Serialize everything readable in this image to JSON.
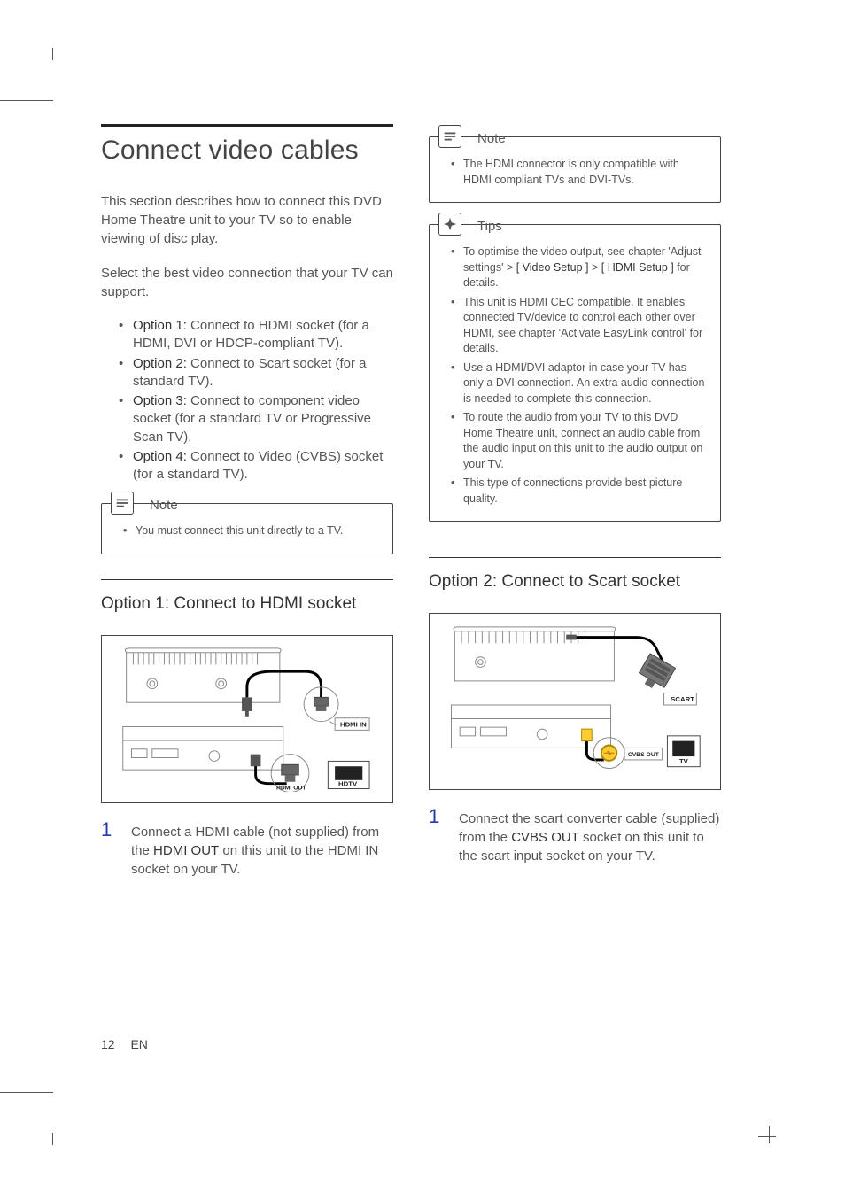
{
  "section": {
    "title": "Connect video cables",
    "intro1": "This section describes how to connect this DVD Home Theatre unit to your TV so to enable viewing of disc play.",
    "intro2": "Select the best video connection that your TV can support."
  },
  "options": [
    {
      "label": "Option 1:",
      "text": " Connect to HDMI socket (for a HDMI, DVI or HDCP-compliant TV)."
    },
    {
      "label": "Option 2:",
      "text": " Connect to Scart socket (for a standard TV)."
    },
    {
      "label": "Option 3:",
      "text": " Connect to component video socket (for a standard TV or Progressive Scan TV)."
    },
    {
      "label": "Option 4:",
      "text": " Connect to Video (CVBS) socket (for a standard TV)."
    }
  ],
  "note1": {
    "title": "Note",
    "items": [
      "You must connect this unit directly to a TV."
    ]
  },
  "opt1": {
    "heading": "Option 1: Connect to HDMI socket",
    "step_num": "1",
    "step_pre": "Connect a HDMI cable (not supplied) from the ",
    "step_bold": "HDMI OUT",
    "step_post": " on this unit to the HDMI IN socket on your TV.",
    "fig": {
      "hdmi_in": "HDMI IN",
      "hdmi_out": "HDMI OUT",
      "hdtv": "HDTV"
    }
  },
  "note2": {
    "title": "Note",
    "items": [
      "The HDMI connector is only compatible with HDMI compliant TVs and DVI-TVs."
    ]
  },
  "tips": {
    "title": "Tips",
    "items": [
      {
        "pre": "To optimise the video output, see chapter 'Adjust settings' > ",
        "b1": "[ Video Setup ]",
        "mid": " > ",
        "b2": "[ HDMI Setup ]",
        "post": " for details."
      },
      {
        "text": "This unit is HDMI CEC compatible.  It enables connected TV/device to control each other over HDMI, see chapter 'Activate EasyLink control' for details."
      },
      {
        "text": "Use a HDMI/DVI adaptor in case your TV has only a DVI connection. An extra audio connection is needed to complete this connection."
      },
      {
        "text": "To route the audio from your TV to this DVD Home Theatre unit, connect an audio cable from the audio input on this unit to the audio output on your TV."
      },
      {
        "text": "This type of connections provide best picture quality."
      }
    ]
  },
  "opt2": {
    "heading": "Option 2: Connect to Scart socket",
    "step_num": "1",
    "step_pre": "Connect the scart converter cable (supplied) from the ",
    "step_bold": "CVBS OUT",
    "step_post": " socket on this unit to the scart input socket on your TV.",
    "fig": {
      "scart": "SCART",
      "cvbs_out": "CVBS OUT",
      "tv": "TV"
    }
  },
  "footer": {
    "page": "12",
    "lang": "EN"
  }
}
